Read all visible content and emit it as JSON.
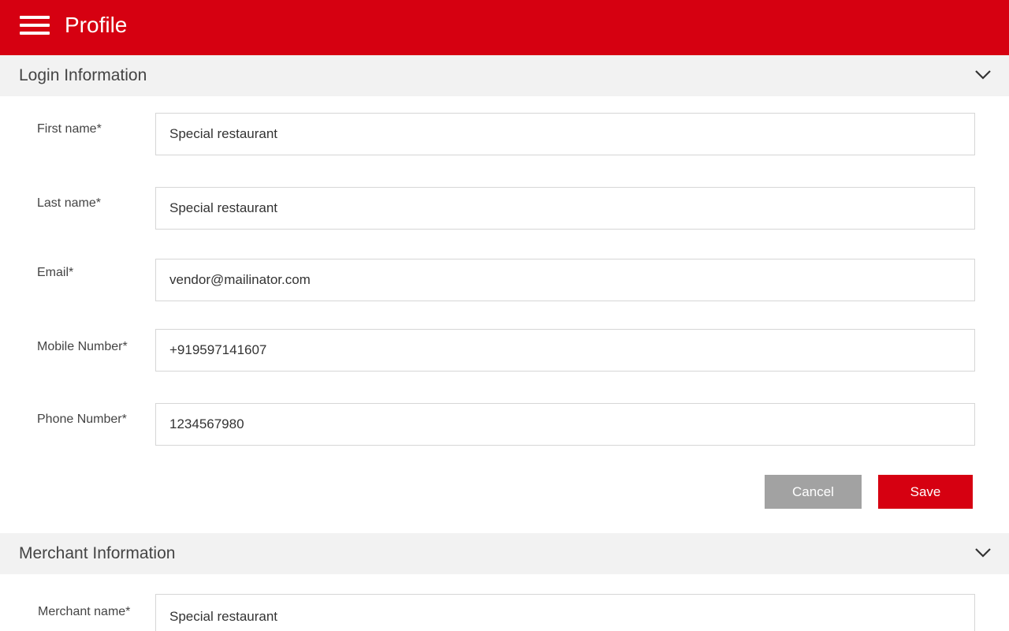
{
  "appbar": {
    "title": "Profile",
    "menu_icon": "hamburger-menu-icon",
    "background": "#d60011"
  },
  "login_section": {
    "title": "Login Information",
    "chevron_icon": "chevron-down-icon",
    "fields": [
      {
        "label": "First name*",
        "value": "Special restaurant"
      },
      {
        "label": "Last name*",
        "value": "Special restaurant"
      },
      {
        "label": "Email*",
        "value": "vendor@mailinator.com"
      },
      {
        "label": "Mobile Number*",
        "value": "+919597141607"
      },
      {
        "label": "Phone Number*",
        "value": "1234567980"
      }
    ],
    "cancel_label": "Cancel",
    "save_label": "Save"
  },
  "merchant_section": {
    "title": "Merchant Information",
    "chevron_icon": "chevron-down-icon",
    "fields": [
      {
        "label": "Merchant name*",
        "value": "Special restaurant"
      }
    ]
  },
  "colors": {
    "accent": "#d60011",
    "cancel": "#a2a2a2",
    "section_bg": "#f2f2f2"
  }
}
